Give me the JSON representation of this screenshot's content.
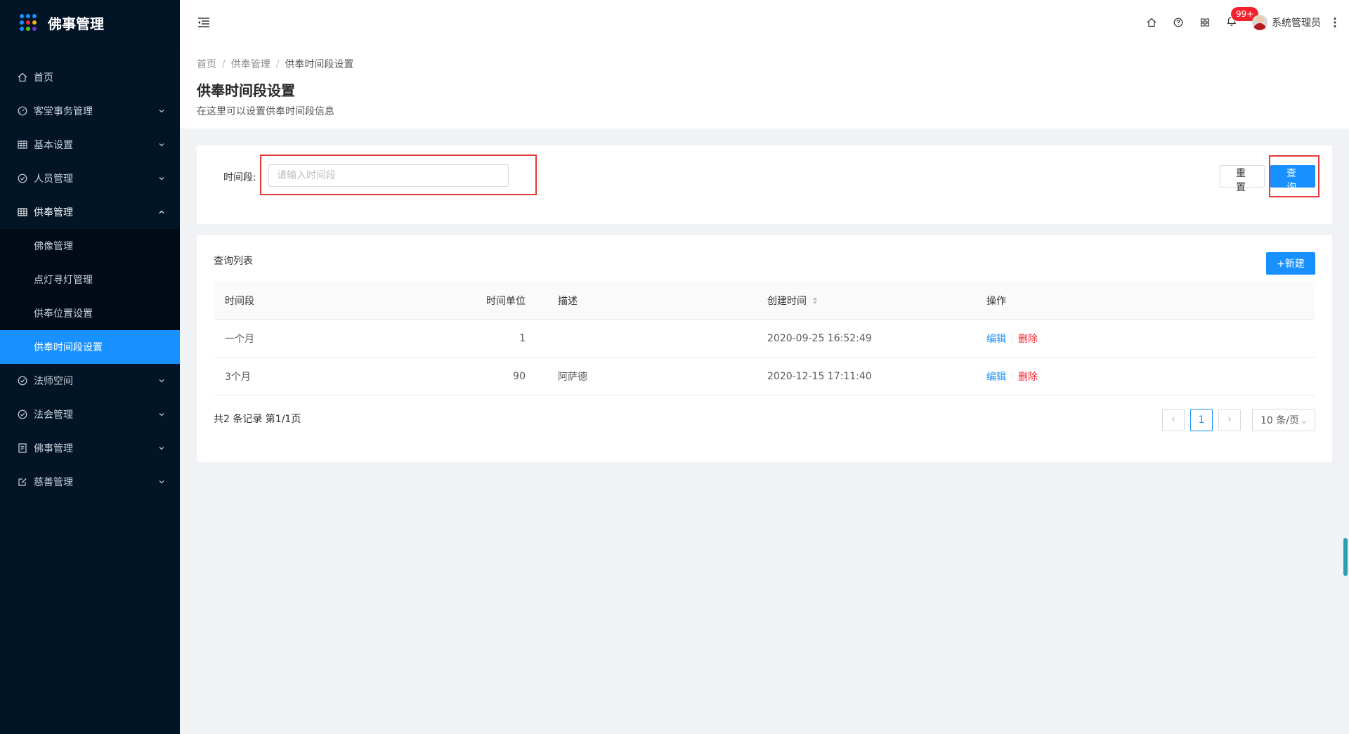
{
  "app": {
    "title": "佛事管理",
    "logo_dot_colors": [
      "#1890ff",
      "#1890ff",
      "#1890ff",
      "#1890ff",
      "#f5222d",
      "#faad14",
      "#1890ff",
      "#52c41a",
      "#722ed1"
    ]
  },
  "sidebar": {
    "items": [
      {
        "label": "首页",
        "icon": "home-icon"
      },
      {
        "label": "客堂事务管理",
        "icon": "dashboard-icon"
      },
      {
        "label": "基本设置",
        "icon": "table-icon"
      },
      {
        "label": "人员管理",
        "icon": "check-circle-icon"
      },
      {
        "label": "供奉管理",
        "icon": "table-icon"
      },
      {
        "label": "法师空间",
        "icon": "check-circle-icon"
      },
      {
        "label": "法会管理",
        "icon": "check-circle-icon"
      },
      {
        "label": "佛事管理",
        "icon": "profile-icon"
      },
      {
        "label": "慈善管理",
        "icon": "edit-icon"
      }
    ],
    "submenu": [
      {
        "label": "佛像管理"
      },
      {
        "label": "点灯寻灯管理"
      },
      {
        "label": "供奉位置设置"
      },
      {
        "label": "供奉时间段设置"
      }
    ]
  },
  "header": {
    "notification_count": "99+",
    "username": "系统管理员"
  },
  "page": {
    "breadcrumb": [
      "首页",
      "供奉管理",
      "供奉时间段设置"
    ],
    "separator": "/",
    "title": "供奉时间段设置",
    "description": "在这里可以设置供奉时间段信息"
  },
  "search": {
    "label": "时间段:",
    "placeholder": "请输入时间段",
    "value": "",
    "reset_label": "重置",
    "query_label": "查询"
  },
  "table": {
    "title": "查询列表",
    "new_label": "+新建",
    "columns": [
      "时间段",
      "时间单位",
      "描述",
      "创建时间",
      "操作"
    ],
    "rows": [
      {
        "period": "一个月",
        "unit": "1",
        "desc": "",
        "created": "2020-09-25 16:52:49",
        "edit": "编辑",
        "delete": "删除"
      },
      {
        "period": "3个月",
        "unit": "90",
        "desc": "阿萨德",
        "created": "2020-12-15 17:11:40",
        "edit": "编辑",
        "delete": "删除"
      }
    ]
  },
  "pagination": {
    "total_text": "共2 条记录 第1/1页",
    "current_page": "1",
    "page_size": "10 条/页"
  },
  "colors": {
    "sidebar_bg": "#021527",
    "submenu_bg": "#000b16",
    "primary": "#1890ff",
    "danger": "#f5222d",
    "highlight": "#e53935"
  }
}
